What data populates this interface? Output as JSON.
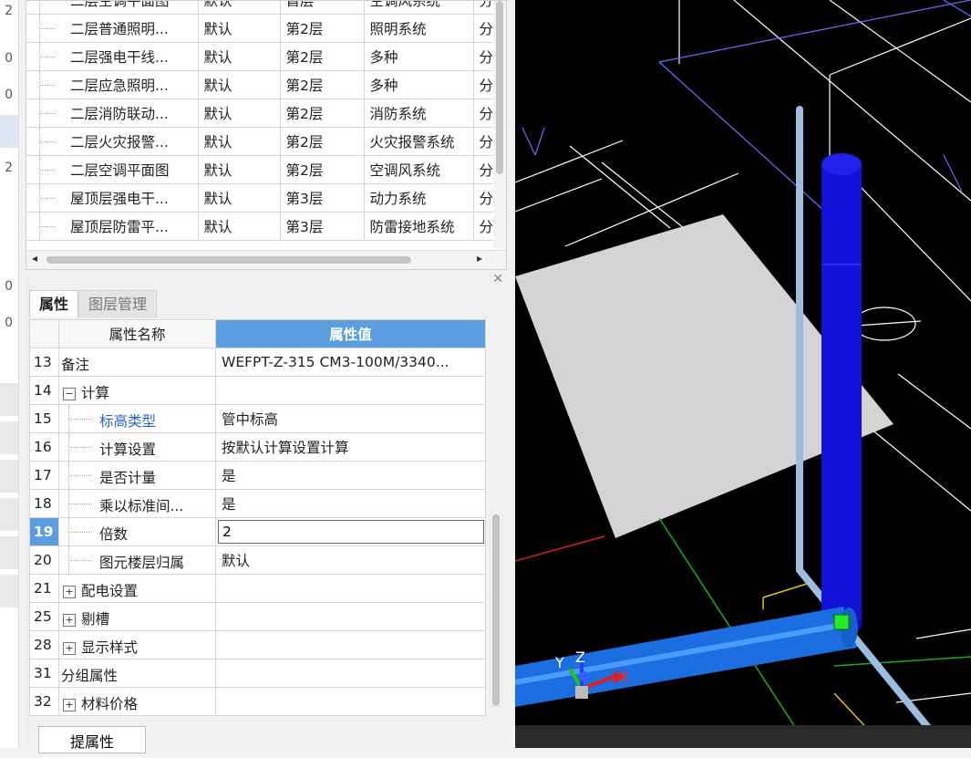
{
  "drawing_list": {
    "rows": [
      {
        "name": "二层空调平面图",
        "type": "默认",
        "floor": "首层",
        "system": "空调风系统",
        "extra": "分"
      },
      {
        "name": "二层普通照明...",
        "type": "默认",
        "floor": "第2层",
        "system": "照明系统",
        "extra": "分"
      },
      {
        "name": "二层强电干线...",
        "type": "默认",
        "floor": "第2层",
        "system": "多种",
        "extra": "分"
      },
      {
        "name": "二层应急照明...",
        "type": "默认",
        "floor": "第2层",
        "system": "多种",
        "extra": "分"
      },
      {
        "name": "二层消防联动...",
        "type": "默认",
        "floor": "第2层",
        "system": "消防系统",
        "extra": "分"
      },
      {
        "name": "二层火灾报警...",
        "type": "默认",
        "floor": "第2层",
        "system": "火灾报警系统",
        "extra": "分"
      },
      {
        "name": "二层空调平面图",
        "type": "默认",
        "floor": "第2层",
        "system": "空调风系统",
        "extra": "分"
      },
      {
        "name": "屋顶层强电干...",
        "type": "默认",
        "floor": "第3层",
        "system": "动力系统",
        "extra": "分"
      },
      {
        "name": "屋顶层防雷平...",
        "type": "默认",
        "floor": "第3层",
        "system": "防雷接地系统",
        "extra": "分"
      }
    ]
  },
  "tabs": {
    "properties": "属性",
    "layers": "图层管理"
  },
  "prop_grid": {
    "header": {
      "name": "属性名称",
      "value": "属性值"
    },
    "rows": [
      {
        "num": "13",
        "name": "备注",
        "value": "WEFPT-Z-315 CM3-100M/3340...",
        "indent": 0,
        "expander": ""
      },
      {
        "num": "14",
        "name": "计算",
        "value": "",
        "indent": 0,
        "expander": "−"
      },
      {
        "num": "15",
        "name": "标高类型",
        "value": "管中标高",
        "indent": 1,
        "expander": "",
        "link": true
      },
      {
        "num": "16",
        "name": "计算设置",
        "value": "按默认计算设置计算",
        "indent": 1,
        "expander": ""
      },
      {
        "num": "17",
        "name": "是否计量",
        "value": "是",
        "indent": 1,
        "expander": ""
      },
      {
        "num": "18",
        "name": "乘以标准间...",
        "value": "是",
        "indent": 1,
        "expander": ""
      },
      {
        "num": "19",
        "name": "倍数",
        "value": "2",
        "indent": 1,
        "expander": "",
        "selected": true
      },
      {
        "num": "20",
        "name": "图元楼层归属",
        "value": "默认",
        "indent": 1,
        "expander": ""
      },
      {
        "num": "21",
        "name": "配电设置",
        "value": "",
        "indent": 0,
        "expander": "+"
      },
      {
        "num": "25",
        "name": "剔槽",
        "value": "",
        "indent": 0,
        "expander": "+"
      },
      {
        "num": "28",
        "name": "显示样式",
        "value": "",
        "indent": 0,
        "expander": "+"
      },
      {
        "num": "31",
        "name": "分组属性",
        "value": "",
        "indent": 0,
        "expander": ""
      },
      {
        "num": "32",
        "name": "材料价格",
        "value": "",
        "indent": 0,
        "expander": "+"
      }
    ]
  },
  "buttons": {
    "extract": "提属性"
  },
  "axis": {
    "x": "X",
    "y": "Y",
    "z": "Z"
  },
  "left_strip": {
    "glyphs": [
      "2",
      "0",
      "0",
      "2",
      "0",
      "0"
    ]
  },
  "icons": {
    "close": "close-icon",
    "scroll_left": "arrow-left-icon",
    "scroll_right": "arrow-right-icon"
  }
}
